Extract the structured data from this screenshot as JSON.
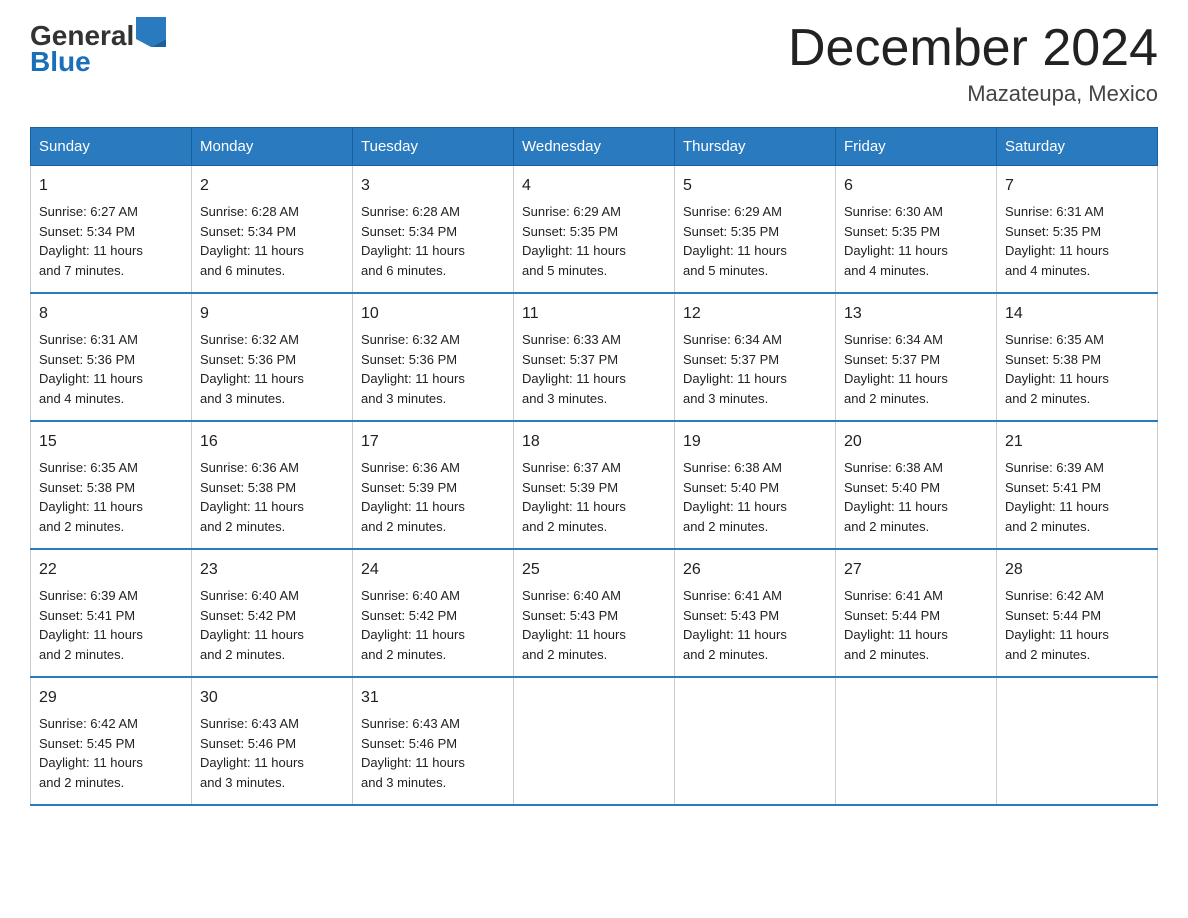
{
  "logo": {
    "general": "General",
    "blue": "Blue"
  },
  "title": "December 2024",
  "location": "Mazateupa, Mexico",
  "days_of_week": [
    "Sunday",
    "Monday",
    "Tuesday",
    "Wednesday",
    "Thursday",
    "Friday",
    "Saturday"
  ],
  "weeks": [
    [
      {
        "day": "1",
        "sunrise": "6:27 AM",
        "sunset": "5:34 PM",
        "daylight": "11 hours and 7 minutes."
      },
      {
        "day": "2",
        "sunrise": "6:28 AM",
        "sunset": "5:34 PM",
        "daylight": "11 hours and 6 minutes."
      },
      {
        "day": "3",
        "sunrise": "6:28 AM",
        "sunset": "5:34 PM",
        "daylight": "11 hours and 6 minutes."
      },
      {
        "day": "4",
        "sunrise": "6:29 AM",
        "sunset": "5:35 PM",
        "daylight": "11 hours and 5 minutes."
      },
      {
        "day": "5",
        "sunrise": "6:29 AM",
        "sunset": "5:35 PM",
        "daylight": "11 hours and 5 minutes."
      },
      {
        "day": "6",
        "sunrise": "6:30 AM",
        "sunset": "5:35 PM",
        "daylight": "11 hours and 4 minutes."
      },
      {
        "day": "7",
        "sunrise": "6:31 AM",
        "sunset": "5:35 PM",
        "daylight": "11 hours and 4 minutes."
      }
    ],
    [
      {
        "day": "8",
        "sunrise": "6:31 AM",
        "sunset": "5:36 PM",
        "daylight": "11 hours and 4 minutes."
      },
      {
        "day": "9",
        "sunrise": "6:32 AM",
        "sunset": "5:36 PM",
        "daylight": "11 hours and 3 minutes."
      },
      {
        "day": "10",
        "sunrise": "6:32 AM",
        "sunset": "5:36 PM",
        "daylight": "11 hours and 3 minutes."
      },
      {
        "day": "11",
        "sunrise": "6:33 AM",
        "sunset": "5:37 PM",
        "daylight": "11 hours and 3 minutes."
      },
      {
        "day": "12",
        "sunrise": "6:34 AM",
        "sunset": "5:37 PM",
        "daylight": "11 hours and 3 minutes."
      },
      {
        "day": "13",
        "sunrise": "6:34 AM",
        "sunset": "5:37 PM",
        "daylight": "11 hours and 2 minutes."
      },
      {
        "day": "14",
        "sunrise": "6:35 AM",
        "sunset": "5:38 PM",
        "daylight": "11 hours and 2 minutes."
      }
    ],
    [
      {
        "day": "15",
        "sunrise": "6:35 AM",
        "sunset": "5:38 PM",
        "daylight": "11 hours and 2 minutes."
      },
      {
        "day": "16",
        "sunrise": "6:36 AM",
        "sunset": "5:38 PM",
        "daylight": "11 hours and 2 minutes."
      },
      {
        "day": "17",
        "sunrise": "6:36 AM",
        "sunset": "5:39 PM",
        "daylight": "11 hours and 2 minutes."
      },
      {
        "day": "18",
        "sunrise": "6:37 AM",
        "sunset": "5:39 PM",
        "daylight": "11 hours and 2 minutes."
      },
      {
        "day": "19",
        "sunrise": "6:38 AM",
        "sunset": "5:40 PM",
        "daylight": "11 hours and 2 minutes."
      },
      {
        "day": "20",
        "sunrise": "6:38 AM",
        "sunset": "5:40 PM",
        "daylight": "11 hours and 2 minutes."
      },
      {
        "day": "21",
        "sunrise": "6:39 AM",
        "sunset": "5:41 PM",
        "daylight": "11 hours and 2 minutes."
      }
    ],
    [
      {
        "day": "22",
        "sunrise": "6:39 AM",
        "sunset": "5:41 PM",
        "daylight": "11 hours and 2 minutes."
      },
      {
        "day": "23",
        "sunrise": "6:40 AM",
        "sunset": "5:42 PM",
        "daylight": "11 hours and 2 minutes."
      },
      {
        "day": "24",
        "sunrise": "6:40 AM",
        "sunset": "5:42 PM",
        "daylight": "11 hours and 2 minutes."
      },
      {
        "day": "25",
        "sunrise": "6:40 AM",
        "sunset": "5:43 PM",
        "daylight": "11 hours and 2 minutes."
      },
      {
        "day": "26",
        "sunrise": "6:41 AM",
        "sunset": "5:43 PM",
        "daylight": "11 hours and 2 minutes."
      },
      {
        "day": "27",
        "sunrise": "6:41 AM",
        "sunset": "5:44 PM",
        "daylight": "11 hours and 2 minutes."
      },
      {
        "day": "28",
        "sunrise": "6:42 AM",
        "sunset": "5:44 PM",
        "daylight": "11 hours and 2 minutes."
      }
    ],
    [
      {
        "day": "29",
        "sunrise": "6:42 AM",
        "sunset": "5:45 PM",
        "daylight": "11 hours and 2 minutes."
      },
      {
        "day": "30",
        "sunrise": "6:43 AM",
        "sunset": "5:46 PM",
        "daylight": "11 hours and 3 minutes."
      },
      {
        "day": "31",
        "sunrise": "6:43 AM",
        "sunset": "5:46 PM",
        "daylight": "11 hours and 3 minutes."
      },
      null,
      null,
      null,
      null
    ]
  ],
  "labels": {
    "sunrise": "Sunrise:",
    "sunset": "Sunset:",
    "daylight": "Daylight:"
  }
}
